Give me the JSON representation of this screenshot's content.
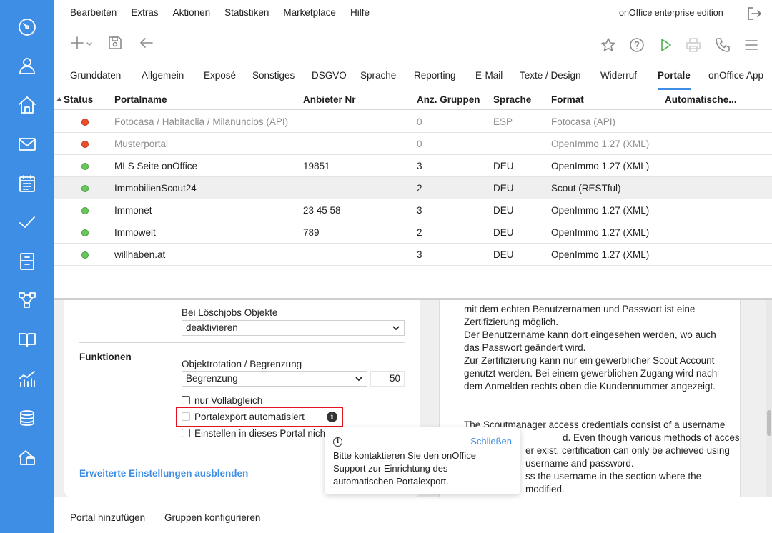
{
  "menu": {
    "items": [
      "Bearbeiten",
      "Extras",
      "Aktionen",
      "Statistiken",
      "Marketplace",
      "Hilfe"
    ],
    "edition": "onOffice enterprise edition"
  },
  "toolbar": {
    "icons": [
      "plus-icon",
      "save-icon",
      "back-arrow-icon",
      "star-icon",
      "help-icon",
      "play-icon",
      "print-icon",
      "phone-icon",
      "hamburger-menu-icon"
    ]
  },
  "sidebar": {
    "icons": [
      "dashboard-icon",
      "address-icon",
      "property-icon",
      "email-icon",
      "calendar-icon",
      "tasks-icon",
      "files-icon",
      "process-icon",
      "manual-icon",
      "statistics-icon",
      "database-icon",
      "marketplace-icon"
    ]
  },
  "tabs": [
    "Grunddaten",
    "Allgemein",
    "Exposé",
    "Sonstiges",
    "DSGVO",
    "Sprache",
    "Reporting",
    "E-Mail",
    "Texte / Design",
    "Widerruf",
    "Portale",
    "onOffice App"
  ],
  "active_tab": "Portale",
  "table": {
    "headers": [
      "Status",
      "Portalname",
      "Anbieter Nr",
      "Anz. Gruppen",
      "Sprache",
      "Format",
      "Automatische..."
    ],
    "rows": [
      {
        "status": "red",
        "name": "Fotocasa / Habitaclia / Milanuncios (API)",
        "anbieter": "",
        "gruppen": "0",
        "sprache": "ESP",
        "format": "Fotocasa (API)"
      },
      {
        "status": "red",
        "name": "Musterportal",
        "anbieter": "",
        "gruppen": "0",
        "sprache": "",
        "format": "OpenImmo 1.27 (XML)"
      },
      {
        "status": "green",
        "name": "MLS Seite onOffice",
        "anbieter": "19851",
        "gruppen": "3",
        "sprache": "DEU",
        "format": "OpenImmo 1.27 (XML)"
      },
      {
        "status": "green",
        "name": "ImmobilienScout24",
        "anbieter": "",
        "gruppen": "2",
        "sprache": "DEU",
        "format": "Scout (RESTful)"
      },
      {
        "status": "green",
        "name": "Immonet",
        "anbieter": "23 45 58",
        "gruppen": "3",
        "sprache": "DEU",
        "format": "OpenImmo 1.27 (XML)"
      },
      {
        "status": "green",
        "name": "Immowelt",
        "anbieter": "789",
        "gruppen": "2",
        "sprache": "DEU",
        "format": "OpenImmo 1.27 (XML)"
      },
      {
        "status": "green",
        "name": "willhaben.at",
        "anbieter": "",
        "gruppen": "3",
        "sprache": "DEU",
        "format": "OpenImmo 1.27 (XML)"
      }
    ]
  },
  "settings": {
    "loeschjobs_label": "Bei Löschjobs Objekte",
    "loeschjobs_value": "deaktivieren",
    "section_title": "Funktionen",
    "rotation_label": "Objektrotation / Begrenzung",
    "rotation_value": "Begrenzung",
    "rotation_number": "50",
    "cb_vollabgleich": "nur Vollabgleich",
    "cb_automatisiert": "Portalexport automatisiert",
    "cb_einstellen": "Einstellen in dieses Portal nich",
    "advanced_link": "Erweiterte Einstellungen ausblenden"
  },
  "text_panel": {
    "lines": [
      "mit dem echten Benutzernamen und Passwort ist eine",
      "Zertifizierung möglich.",
      "Der Benutzername kann dort eingesehen werden, wo auch",
      "das Passwort geändert wird.",
      "Zur Zertifizierung kann nur ein gewerblicher Scout Account",
      "genutzt werden. Bei einem gewerblichen Zugang wird nach",
      "dem Anmelden rechts oben die Kundennummer angezeigt.",
      "__________",
      "",
      "The Scoutmanager access credentials consist of a username",
      "d. Even though various methods of accessing",
      "er exist, certification can only be achieved using",
      "username and password.",
      "ss the username in the section where the",
      "modified."
    ]
  },
  "popover": {
    "close_label": "Schließen",
    "text": "Bitte kontaktieren Sie den onOffice Support zur Einrichtung des automatischen Portalexport."
  },
  "footer": {
    "add_portal": "Portal hinzufügen",
    "configure_groups": "Gruppen konfigurieren"
  }
}
